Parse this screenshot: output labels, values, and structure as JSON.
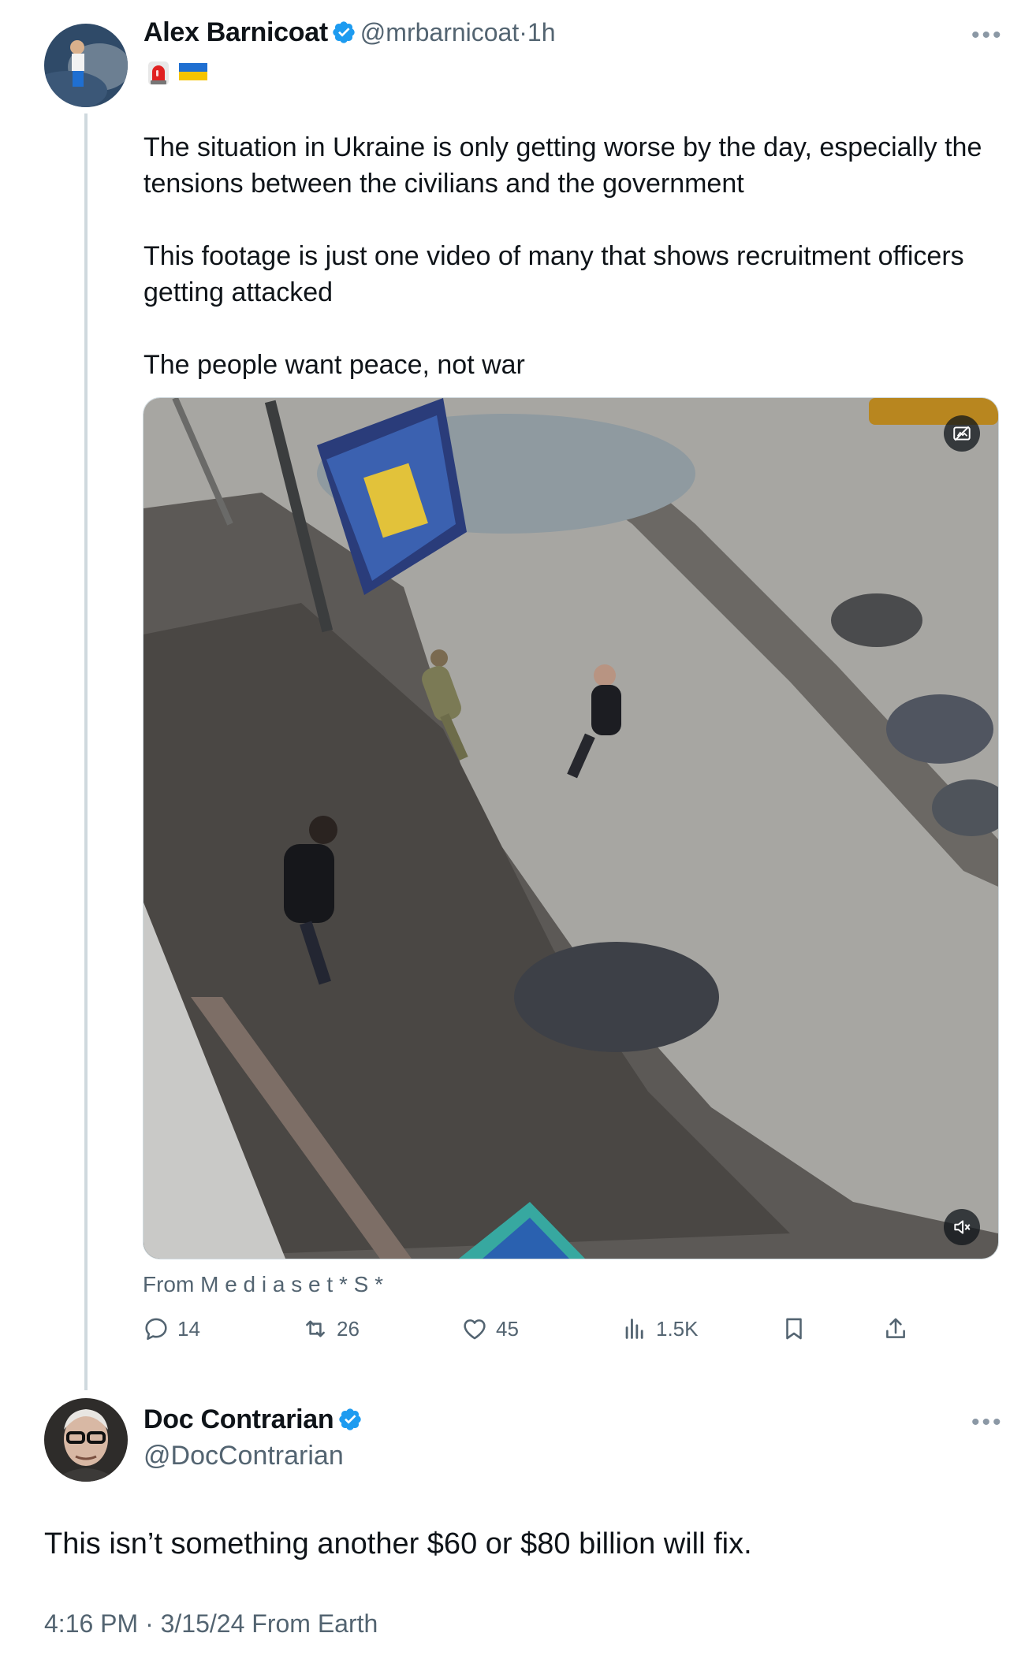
{
  "tweet": {
    "author_name": "Alex Barnicoat",
    "handle": "@mrbarnicoat",
    "separator": "·",
    "time": "1h",
    "flair_icons": [
      "rotating-light-emoji",
      "ukraine-flag-emoji"
    ],
    "body": "The situation in Ukraine is only getting worse by the day, especially the tensions between the civilians and the government\n\nThis footage is just one video of many that shows recruitment officers getting attacked\n\nThe people want peace, not war",
    "media_source": "From M e d i a s e t * S *",
    "stats": {
      "replies": "14",
      "retweets": "26",
      "likes": "45",
      "views": "1.5K"
    }
  },
  "reply": {
    "author_name": "Doc Contrarian",
    "handle": "@DocContrarian",
    "body": "This isn’t something another $60 or $80 billion will fix.",
    "timestamp": "4:16 PM · 3/15/24 From Earth"
  },
  "colors": {
    "verified_blue": "#1d9bf0",
    "text_primary": "#0f1419",
    "text_secondary": "#536471"
  }
}
